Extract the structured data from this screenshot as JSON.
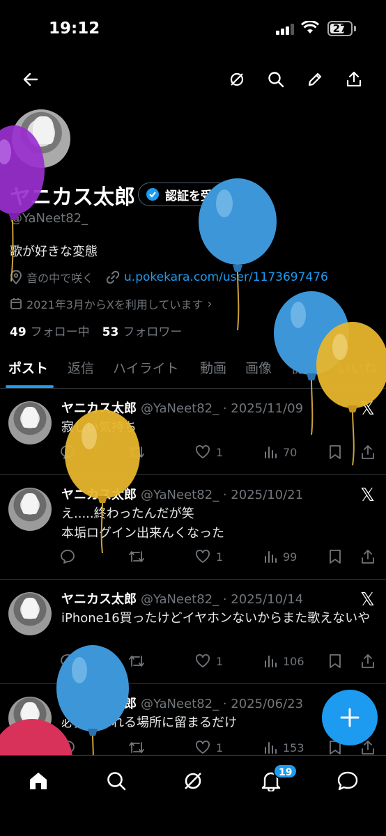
{
  "status": {
    "time": "19:12",
    "battery": "27"
  },
  "profile": {
    "display_name": "ヤニカス太郎",
    "verify_label": "認証を受ける",
    "handle": "@YaNeet82_",
    "bio": "歌が好きな変態",
    "location": "音の中で咲く",
    "link": "u.pokekara.com/user/1173697476",
    "joined": "2021年3月からXを利用しています",
    "following_count": "49",
    "following_label": "フォロー中",
    "followers_count": "53",
    "followers_label": "フォロワー"
  },
  "tabs": [
    "ポスト",
    "返信",
    "ハイライト",
    "動画",
    "画像",
    "記事",
    "いいね"
  ],
  "posts": [
    {
      "name": "ヤニカス太郎",
      "meta": "@YaNeet82_ · 2025/11/09",
      "text": "寂しい気持ち",
      "likes": "1",
      "views": "70",
      "replies": "",
      "reposts": ""
    },
    {
      "name": "ヤニカス太郎",
      "meta": "@YaNeet82_ · 2025/10/21",
      "text": "え.....終わったんだが笑\n本垢ログイン出来んくなった",
      "likes": "1",
      "views": "99",
      "replies": "",
      "reposts": ""
    },
    {
      "name": "ヤニカス太郎",
      "meta": "@YaNeet82_ · 2025/10/14",
      "text": "iPhone16買ったけどイヤホンないからまた歌えないや",
      "likes": "1",
      "views": "106",
      "replies": "",
      "reposts": ""
    },
    {
      "name": "ヤニカス太郎",
      "meta": "@YaNeet82_ · 2025/06/23",
      "text": "必要とされる場所に留まるだけ",
      "likes": "1",
      "views": "153",
      "replies": "",
      "reposts": ""
    }
  ],
  "notifications_badge": "19",
  "colors": {
    "accent": "#1d9bf0",
    "background": "#000000",
    "muted": "#71767b"
  },
  "icons": [
    "back-arrow-icon",
    "grok-icon",
    "search-icon",
    "pencil-icon",
    "share-icon",
    "home-icon",
    "bell-icon",
    "message-icon",
    "plus-icon",
    "x-logo-icon"
  ]
}
